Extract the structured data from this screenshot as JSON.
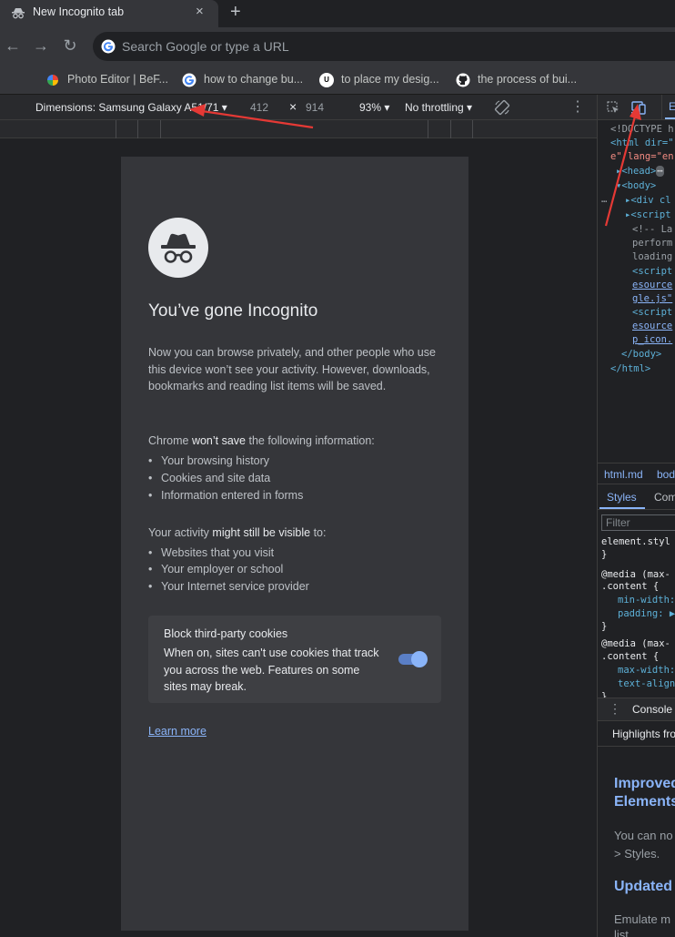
{
  "browser": {
    "tab_title": "New Incognito tab",
    "tab_close": "×",
    "new_tab": "+",
    "omnibox_placeholder": "Search Google or type a URL",
    "bookmarks": [
      "Photo Editor | BeF...",
      "how to change bu...",
      "to place my desig...",
      "the process of bui..."
    ]
  },
  "device_toolbar": {
    "dimensions_label": "Dimensions: Samsung Galaxy A51/71",
    "width": "412",
    "times": "×",
    "height": "914",
    "zoom": "93%",
    "throttling": "No throttling"
  },
  "page": {
    "title": "You’ve gone Incognito",
    "intro": "Now you can browse privately, and other people who use this device won’t see your activity. However, downloads, bookmarks and reading list items will be saved.",
    "wont_save_prefix": "Chrome ",
    "wont_save_bold": "won’t save",
    "wont_save_suffix": " the following information:",
    "wont_save_items": [
      "Your browsing history",
      "Cookies and site data",
      "Information entered in forms"
    ],
    "visible_prefix": "Your activity ",
    "visible_bold": "might still be visible",
    "visible_suffix": " to:",
    "visible_items": [
      "Websites that you visit",
      "Your employer or school",
      "Your Internet service provider"
    ],
    "cookie_title": "Block third-party cookies",
    "cookie_desc": "When on, sites can't use cookies that track you across the web. Features on some sites may break.",
    "cookie_toggle_on": true,
    "learn_more": "Learn more"
  },
  "devtools": {
    "elements_lines": [
      "<!DOCTYPE h",
      "<html dir=\"",
      "e\" lang=\"en",
      "<head>",
      "<body>",
      "<div cl",
      "<script",
      "<!-- La",
      "perform",
      "loading",
      "<script",
      "esource",
      "gle.js\"",
      "<script",
      "esource",
      "p_icon.",
      "</body>",
      "</html>"
    ],
    "crumb_file": "html.md",
    "crumb_body": "bod",
    "tab_styles": "Styles",
    "tab_computed": "Com",
    "filter_placeholder": "Filter",
    "styles_lines": [
      "element.styl",
      "}",
      "@media (max-",
      ".content {",
      "min-width:",
      "padding: ▶",
      "}",
      "@media (max-",
      ".content {",
      "max-width:",
      "text-align",
      "}"
    ],
    "drawer_tab": "Console",
    "highlights_tab": "Highlights fro",
    "h1": "Improved",
    "h1b": "Elements",
    "p1": "You can no",
    "p1b": "> Styles.",
    "h2": "Updated",
    "p2": "Emulate m",
    "p2b": "list"
  },
  "colors": {
    "accent": "#8ab4f8",
    "arrow": "#e53935"
  }
}
